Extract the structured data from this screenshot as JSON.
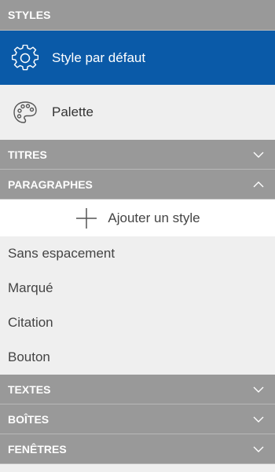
{
  "sections": {
    "styles": "STYLES",
    "titres": "TITRES",
    "paragraphes": "PARAGRAPHES",
    "textes": "TEXTES",
    "boites": "BOÎTES",
    "fenetres": "FENÊTRES"
  },
  "styles_items": {
    "default_label": "Style par défaut",
    "palette_label": "Palette"
  },
  "paragraphes": {
    "add_label": "Ajouter un style",
    "items": [
      "Sans espacement",
      "Marqué",
      "Citation",
      "Bouton"
    ]
  },
  "colors": {
    "header_bg": "#999999",
    "selected_bg": "#0a5aa8",
    "panel_bg": "#efefef"
  },
  "icons": {
    "default": "gear-icon",
    "palette": "palette-icon",
    "add": "plus-icon",
    "collapsed": "chevron-down-icon",
    "expanded": "chevron-up-icon"
  }
}
